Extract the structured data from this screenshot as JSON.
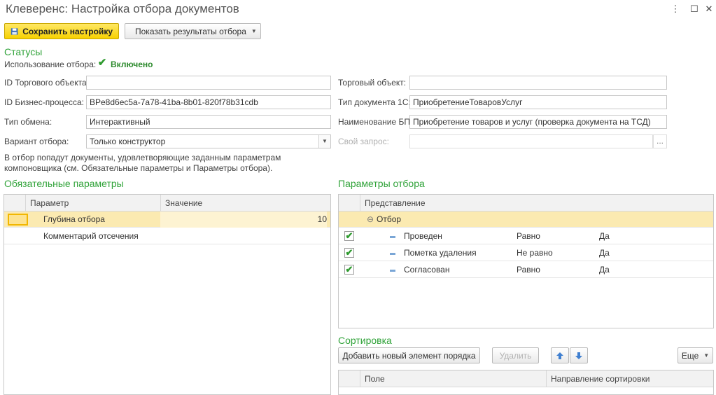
{
  "window": {
    "title": "Клеверенс: Настройка отбора документов",
    "menu_glyph": "⋮",
    "maximize_glyph": "☐",
    "close_glyph": "✕"
  },
  "toolbar": {
    "save_label": "Сохранить настройку",
    "show_results_label": "Показать результаты отбора"
  },
  "statuses": {
    "section_title": "Статусы",
    "usage_label": "Использование отбора:",
    "usage_checked": true,
    "usage_value": "Включено"
  },
  "form_left": {
    "trade_object_id_label": "ID Торгового объекта:",
    "trade_object_id_value": "",
    "business_process_id_label": "ID Бизнес-процесса:",
    "business_process_id_value": "BPe8d6ec5a-7a78-41ba-8b01-820f78b31cdb",
    "exchange_type_label": "Тип обмена:",
    "exchange_type_value": "Интерактивный",
    "filter_variant_label": "Вариант отбора:",
    "filter_variant_value": "Только конструктор",
    "note": "В отбор попадут документы, удовлетворяющие заданным параметрам компоновщика (см. Обязательные параметры и Параметры отбора)."
  },
  "form_right": {
    "trade_object_label": "Торговый объект:",
    "trade_object_value": "",
    "doc_type_label": "Тип документа 1С:",
    "doc_type_value": "ПриобретениеТоваровУслуг",
    "bp_name_label": "Наименование БП:",
    "bp_name_value": "Приобретение товаров и услуг (проверка документа на ТСД)",
    "custom_query_label": "Свой запрос:",
    "custom_query_value": "",
    "custom_query_button": "..."
  },
  "required_params": {
    "section_title": "Обязательные параметры",
    "columns": [
      "Параметр",
      "Значение"
    ],
    "rows": [
      {
        "param": "Глубина отбора",
        "value": "10"
      },
      {
        "param": "Комментарий отсечения",
        "value": ""
      }
    ]
  },
  "filter_params": {
    "section_title": "Параметры отбора",
    "column": "Представление",
    "group_label": "Отбор",
    "group_glyph": "⊖",
    "rows": [
      {
        "checked": true,
        "field": "Проведен",
        "condition": "Равно",
        "value": "Да"
      },
      {
        "checked": true,
        "field": "Пометка удаления",
        "condition": "Не равно",
        "value": "Да"
      },
      {
        "checked": true,
        "field": "Согласован",
        "condition": "Равно",
        "value": "Да"
      }
    ]
  },
  "sorting": {
    "section_title": "Сортировка",
    "add_label": "Добавить новый элемент порядка",
    "delete_label": "Удалить",
    "more_label": "Еще",
    "columns": [
      "Поле",
      "Направление сортировки"
    ]
  },
  "colors": {
    "accent_green": "#31a33a",
    "primary_yellow": "#f7d100",
    "selection": "#fbeab1"
  }
}
